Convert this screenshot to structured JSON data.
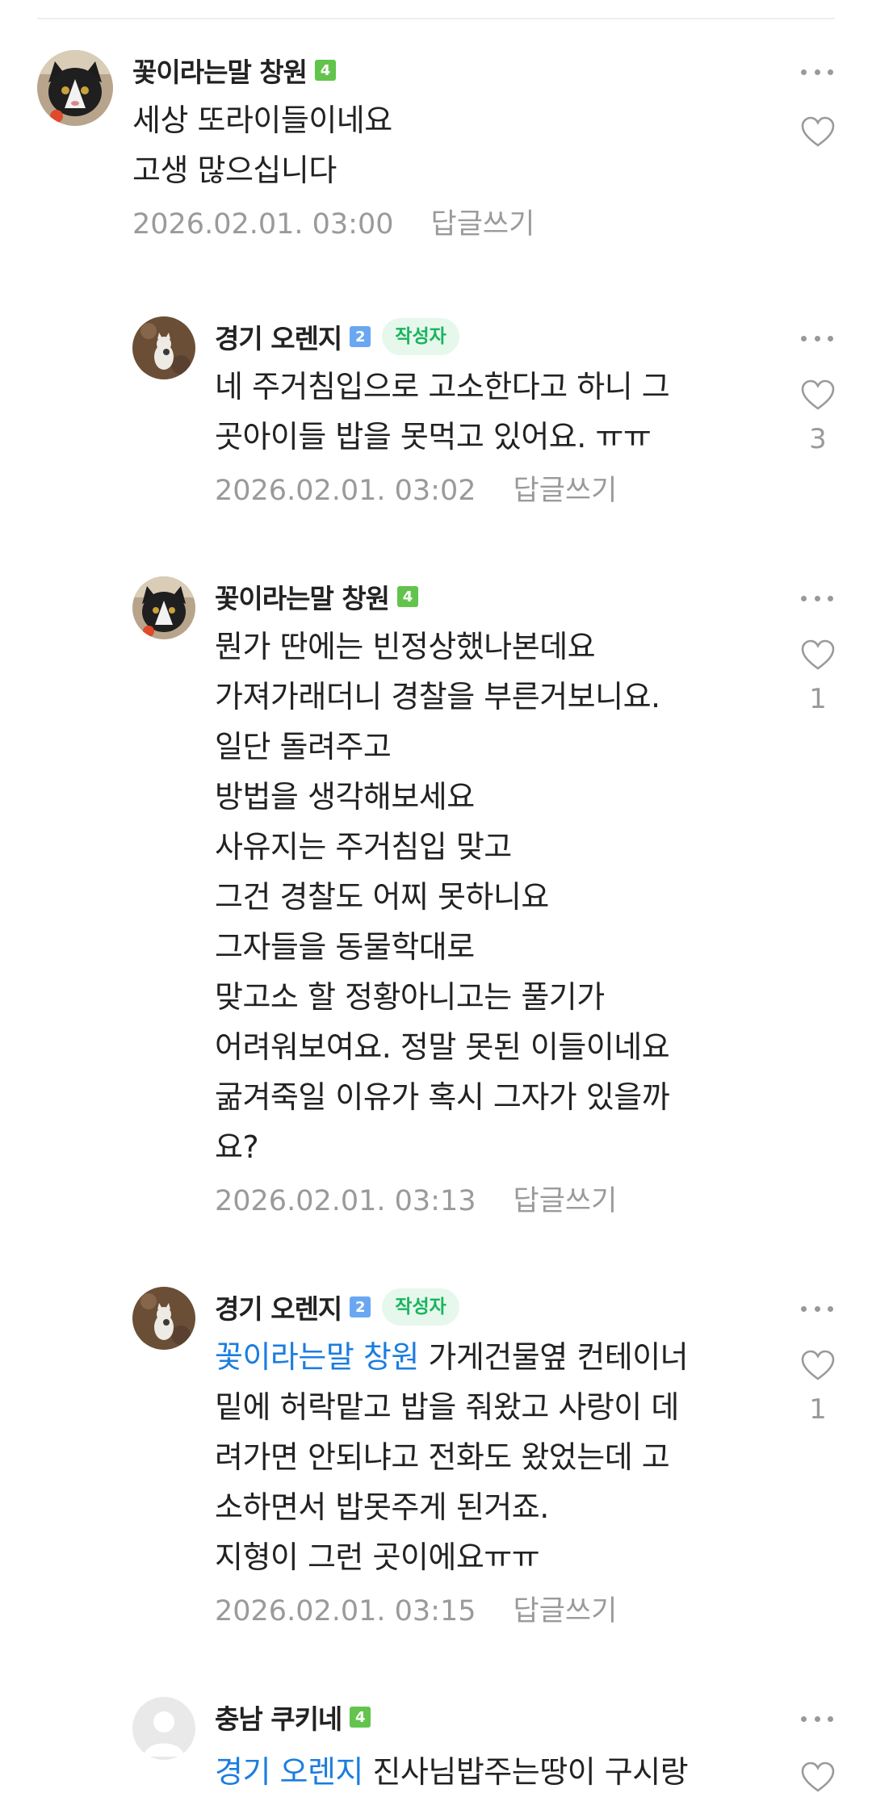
{
  "comments": [
    {
      "author": "꽃이라는말 창원",
      "level": "4",
      "is_writer": false,
      "text_lines": [
        "세상 또라이들이네요",
        "고생 많으십니다"
      ],
      "date": "2026.02.01. 03:00",
      "reply_label": "답글쓰기",
      "likes": ""
    },
    {
      "author": "경기 오렌지",
      "level": "2",
      "is_writer": true,
      "writer_label": "작성자",
      "text_lines": [
        "네 주거침입으로 고소한다고 하니 그",
        "곳아이들 밥을 못먹고 있어요. ㅠㅠ"
      ],
      "date": "2026.02.01. 03:02",
      "reply_label": "답글쓰기",
      "likes": "3"
    },
    {
      "author": "꽃이라는말 창원",
      "level": "4",
      "is_writer": false,
      "text_lines": [
        "뭔가 딴에는 빈정상했나본데요",
        "가져가래더니 경찰을 부른거보니요.",
        "일단 돌려주고",
        "방법을 생각해보세요",
        "사유지는 주거침입 맞고",
        "그건 경찰도 어찌 못하니요",
        "그자들을 동물학대로",
        "맞고소 할 정황아니고는 풀기가",
        "어려워보여요. 정말 못된 이들이네요",
        "굶겨죽일 이유가 혹시 그자가 있을까",
        "요?"
      ],
      "date": "2026.02.01. 03:13",
      "reply_label": "답글쓰기",
      "likes": "1"
    },
    {
      "author": "경기 오렌지",
      "level": "2",
      "is_writer": true,
      "writer_label": "작성자",
      "mention": "꽃이라는말 창원",
      "text_first_rest": " 가게건물옆 컨테이너",
      "text_lines": [
        "밑에 허락맡고 밥을 줘왔고 사랑이 데",
        "려가면 안되냐고 전화도 왔었는데 고",
        "소하면서 밥못주게 된거죠.",
        "지형이 그런 곳이에요ㅠㅠ"
      ],
      "date": "2026.02.01. 03:15",
      "reply_label": "답글쓰기",
      "likes": "1"
    },
    {
      "author": "충남 쿠키네",
      "level": "4",
      "is_writer": false,
      "mention": "경기 오렌지",
      "text_first_rest": " 진사님밥주는땅이 구시랑"
    }
  ],
  "colors": {
    "mention": "#1b7de0",
    "writer_badge_text": "#19b45e",
    "writer_badge_bg": "#e6f8ec",
    "level_green": "#62c44c",
    "level_blue": "#6aa7f2",
    "meta_gray": "#9a9a9a"
  },
  "icons": [
    "more-options-icon",
    "heart-icon",
    "cat-avatar-icon",
    "default-avatar-icon"
  ]
}
